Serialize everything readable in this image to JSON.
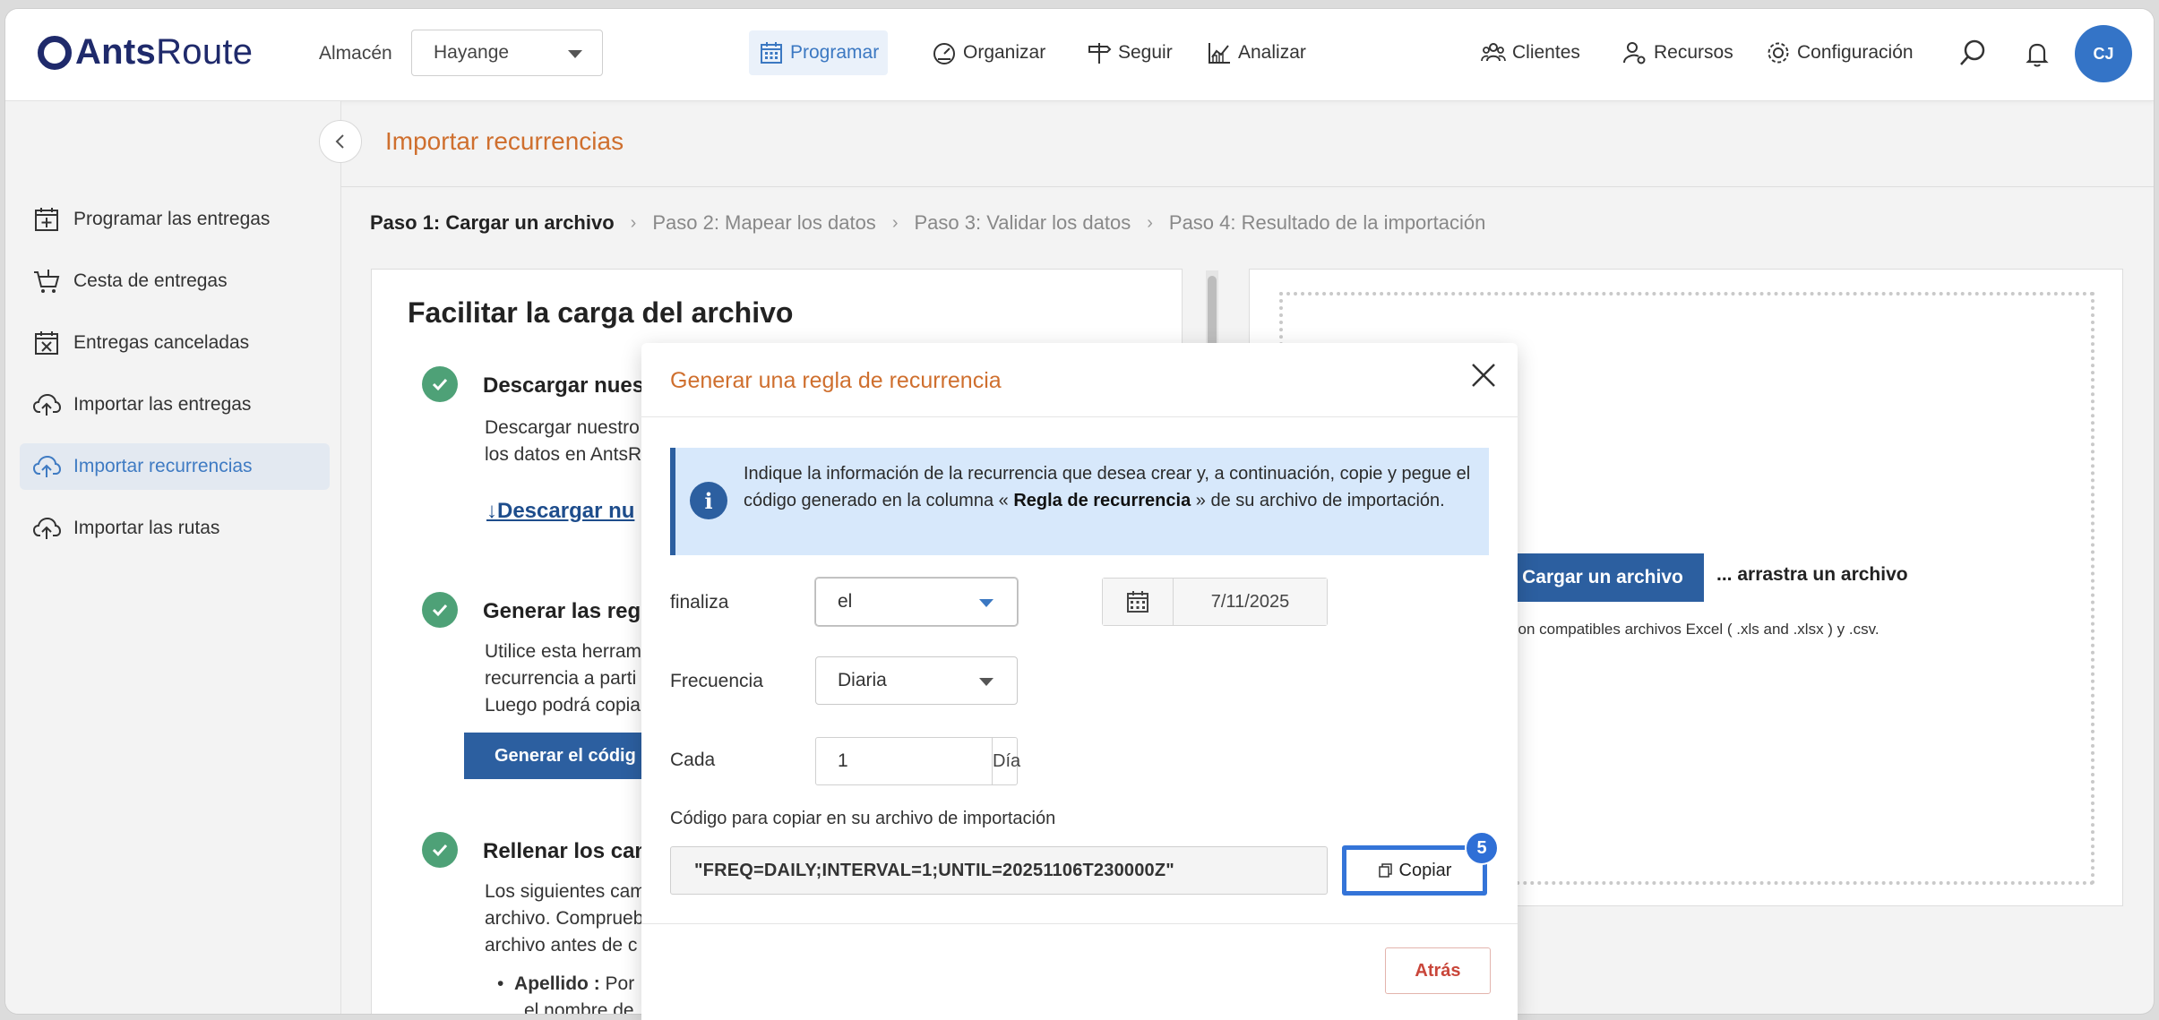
{
  "brand": {
    "name_bold": "Ants",
    "name_rest": "Route"
  },
  "topbar": {
    "warehouse_label": "Almacén",
    "warehouse_value": "Hayange",
    "nav": [
      {
        "label": "Programar",
        "icon": "calendar-icon",
        "active": true
      },
      {
        "label": "Organizar",
        "icon": "gauge-icon"
      },
      {
        "label": "Seguir",
        "icon": "signpost-icon"
      },
      {
        "label": "Analizar",
        "icon": "chart-icon"
      }
    ],
    "right_nav": [
      {
        "label": "Clientes",
        "icon": "people-icon"
      },
      {
        "label": "Recursos",
        "icon": "user-gear-icon"
      },
      {
        "label": "Configuración",
        "icon": "gear-icon"
      }
    ],
    "avatar_initials": "CJ"
  },
  "sidebar": {
    "items": [
      {
        "label": "Programar las entregas",
        "icon": "calendar-plus-icon"
      },
      {
        "label": "Cesta de entregas",
        "icon": "cart-icon"
      },
      {
        "label": "Entregas canceladas",
        "icon": "calendar-x-icon"
      },
      {
        "label": "Importar las entregas",
        "icon": "cloud-upload-icon"
      },
      {
        "label": "Importar recurrencias",
        "icon": "cloud-upload-icon",
        "active": true
      },
      {
        "label": "Importar las rutas",
        "icon": "cloud-upload-icon"
      }
    ]
  },
  "page": {
    "title": "Importar recurrencias",
    "steps": [
      "Paso 1: Cargar un archivo",
      "Paso 2: Mapear los datos",
      "Paso 3: Validar los datos",
      "Paso 4: Resultado de la importación"
    ]
  },
  "left_panel": {
    "title": "Facilitar la carga del archivo",
    "s1_title": "Descargar nuest",
    "s1_line1": "Descargar nuestro",
    "s1_line2": "los datos en AntsR",
    "s1_link": "Descargar nu",
    "s2_title": "Generar las regla",
    "s2_line1": "Utilice esta herram",
    "s2_line2": "recurrencia a parti",
    "s2_line3": "Luego podrá copia",
    "s2_button": "Generar el códig",
    "s3_title": "Rellenar los cam",
    "s3_line1": "Los siguientes cam",
    "s3_line2": "archivo. Comprueb",
    "s3_line3": "archivo antes de c",
    "bullet_bold": "Apellido :",
    "bullet_text": " Por",
    "bullet_line2": "el nombre de"
  },
  "right_panel": {
    "upload_button": "Cargar un archivo",
    "drag_text": "... arrastra un archivo",
    "compat_text": "son compatibles archivos Excel ( .xls and .xlsx ) y .csv."
  },
  "modal": {
    "title": "Generar una regla de recurrencia",
    "info_part1": "Indique la información de la recurrencia que desea crear y, a continuación, copie y pegue el código generado en la columna « ",
    "info_bold": "Regla de recurrencia",
    "info_part2": " » de su archivo de importación.",
    "ends_label": "finaliza",
    "ends_value": "el",
    "date_value": "7/11/2025",
    "freq_label": "Frecuencia",
    "freq_value": "Diaria",
    "every_label": "Cada",
    "every_value": "1",
    "every_unit": "Día",
    "code_label": "Código para copiar en su archivo de importación",
    "code_value": "\"FREQ=DAILY;INTERVAL=1;UNTIL=20251106T230000Z\"",
    "copy_label": "Copiar",
    "copy_badge": "5",
    "back_label": "Atrás"
  },
  "colors": {
    "accent_orange": "#cf6f2e",
    "primary_blue": "#2c5fa0",
    "active_blue": "#3b78c2",
    "info_bg": "#d7e8fb",
    "success_green": "#4ea177",
    "danger_red": "#c9463a"
  }
}
